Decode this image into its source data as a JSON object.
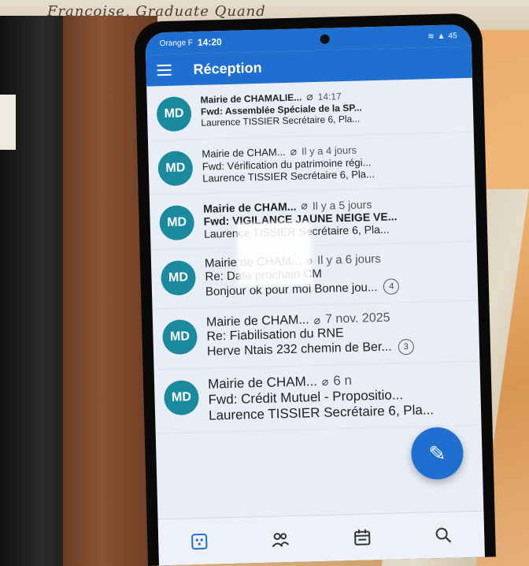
{
  "background": {
    "handwriting": "Françoise, Graduate Quand"
  },
  "statusbar": {
    "carrier": "Orange F",
    "time": "14:20",
    "battery": "45"
  },
  "appbar": {
    "title": "Réception"
  },
  "messages": [
    {
      "avatar": "MD",
      "sender": "Mairie de CHAMALIE...",
      "date": "14:17",
      "subject": "Fwd: Assemblée Spéciale de la SP...",
      "preview": "Laurence TISSIER Secrétaire 6, Pla...",
      "count": "",
      "bold": true
    },
    {
      "avatar": "MD",
      "sender": "Mairie de CHAM...",
      "date": "Il y a 4 jours",
      "subject": "Fwd: Vérification du patrimoine régi...",
      "preview": "Laurence TISSIER Secrétaire 6, Pla...",
      "count": "",
      "bold": false
    },
    {
      "avatar": "MD",
      "sender": "Mairie de CHAM...",
      "date": "Il y a 5 jours",
      "subject": "Fwd: VIGILANCE JAUNE NEIGE VE...",
      "preview": "Laurence TISSIER Secrétaire 6, Pla...",
      "count": "",
      "bold": true
    },
    {
      "avatar": "MD",
      "sender": "Mairie de CHAM...",
      "date": "Il y a 6 jours",
      "subject": "Re: Date prochain CM",
      "preview": "Bonjour ok pour moi Bonne jou...",
      "count": "4",
      "bold": false
    },
    {
      "avatar": "MD",
      "sender": "Mairie de CHAM...",
      "date": "7 nov. 2025",
      "subject": "Re: Fiabilisation du RNE",
      "preview": "Herve Ntais 232 chemin de Ber...",
      "count": "3",
      "bold": false
    },
    {
      "avatar": "MD",
      "sender": "Mairie de CHAM...",
      "date": "6 n",
      "subject": "Fwd: Crédit Mutuel - Propositio...",
      "preview": "Laurence TISSIER Secrétaire 6, Pla...",
      "count": "",
      "bold": false
    }
  ],
  "colors": {
    "accent": "#1e6fd0",
    "avatar": "#1b8a9e"
  },
  "icons": {
    "fab": "pencil-icon",
    "nav": [
      "mail-icon",
      "people-icon",
      "calendar-icon",
      "search-icon"
    ]
  }
}
